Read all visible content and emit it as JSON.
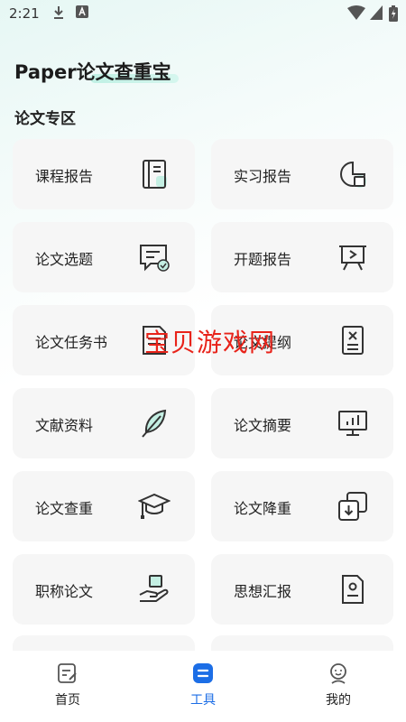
{
  "status": {
    "time": "2:21"
  },
  "header": {
    "title": "Paper论文查重宝"
  },
  "section": {
    "title": "论文专区"
  },
  "cards": [
    {
      "label": "课程报告",
      "icon": "notebook-icon"
    },
    {
      "label": "实习报告",
      "icon": "chart-window-icon"
    },
    {
      "label": "论文选题",
      "icon": "message-check-icon"
    },
    {
      "label": "开题报告",
      "icon": "presentation-icon"
    },
    {
      "label": "论文任务书",
      "icon": "document-icon"
    },
    {
      "label": "论文提纲",
      "icon": "outline-doc-icon"
    },
    {
      "label": "文献资料",
      "icon": "feather-icon"
    },
    {
      "label": "论文摘要",
      "icon": "monitor-chart-icon"
    },
    {
      "label": "论文查重",
      "icon": "graduation-cap-icon"
    },
    {
      "label": "论文降重",
      "icon": "download-layers-icon"
    },
    {
      "label": "职称论文",
      "icon": "hand-box-icon"
    },
    {
      "label": "思想汇报",
      "icon": "person-doc-icon"
    }
  ],
  "watermark": "宝贝游戏网",
  "nav": {
    "home": "首页",
    "tools": "工具",
    "mine": "我的",
    "active_color": "#1c6ee6"
  }
}
